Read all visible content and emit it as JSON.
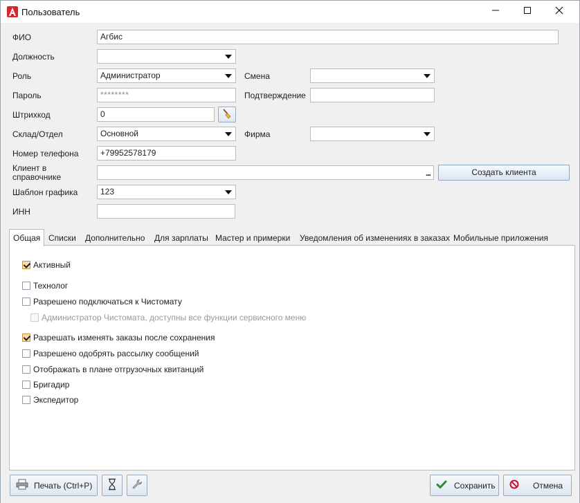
{
  "window": {
    "title": "Пользователь"
  },
  "form": {
    "fio": {
      "label": "ФИО",
      "value": "Агбис"
    },
    "position": {
      "label": "Должность",
      "value": ""
    },
    "role": {
      "label": "Роль",
      "value": "Администратор"
    },
    "shift": {
      "label": "Смена",
      "value": ""
    },
    "password": {
      "label": "Пароль",
      "value": "********"
    },
    "confirm": {
      "label": "Подтверждение",
      "value": ""
    },
    "barcode": {
      "label": "Штрихкод",
      "value": "0"
    },
    "warehouse": {
      "label": "Склад/Отдел",
      "value": "Основной"
    },
    "firm": {
      "label": "Фирма",
      "value": ""
    },
    "phone": {
      "label": "Номер телефона",
      "value": "+79952578179"
    },
    "client": {
      "label_line1": "Клиент в",
      "label_line2": "справочнике",
      "value": "",
      "ellipsis": "...",
      "create_button": "Создать клиента"
    },
    "schedule": {
      "label": "Шаблон графика",
      "value": "123"
    },
    "inn": {
      "label": "ИНН",
      "value": ""
    }
  },
  "tabs": [
    {
      "label": "Общая"
    },
    {
      "label": "Списки"
    },
    {
      "label": "Дополнительно"
    },
    {
      "label": "Для зарплаты"
    },
    {
      "label": "Мастер и примерки"
    },
    {
      "label": "Уведомления об изменениях в заказах"
    },
    {
      "label": "Мобильные приложения"
    }
  ],
  "general": {
    "checkboxes": [
      {
        "label": "Активный",
        "checked": true
      },
      {
        "label": "Технолог",
        "checked": false
      },
      {
        "label": "Разрешено подключаться к Чистомату",
        "checked": false
      },
      {
        "label": "Администратор Чистомата, доступны все функции сервисного меню",
        "checked": false,
        "disabled": true
      },
      {
        "label": "Разрешать изменять заказы после сохранения",
        "checked": true
      },
      {
        "label": "Разрешено одобрять рассылку сообщений",
        "checked": false
      },
      {
        "label": "Отображать в плане отгрузочных квитанций",
        "checked": false
      },
      {
        "label": "Бригадир",
        "checked": false
      },
      {
        "label": "Экспедитор",
        "checked": false
      }
    ]
  },
  "footer": {
    "print_label": "Печать (Ctrl+P)",
    "save_label": "Сохранить",
    "cancel_label": "Отмена"
  },
  "icons": {
    "app": "app-logo-icon",
    "minimize": "minimize-icon",
    "maximize": "maximize-icon",
    "close": "close-icon",
    "broom": "broom-icon",
    "printer": "printer-icon",
    "hourglass": "hourglass-icon",
    "wrench": "wrench-icon",
    "check": "check-icon",
    "cancel": "cancel-icon"
  },
  "colors": {
    "accent_check": "#fbd9a6",
    "save_check": "#2e8b2e",
    "cancel_red": "#c8102e"
  }
}
